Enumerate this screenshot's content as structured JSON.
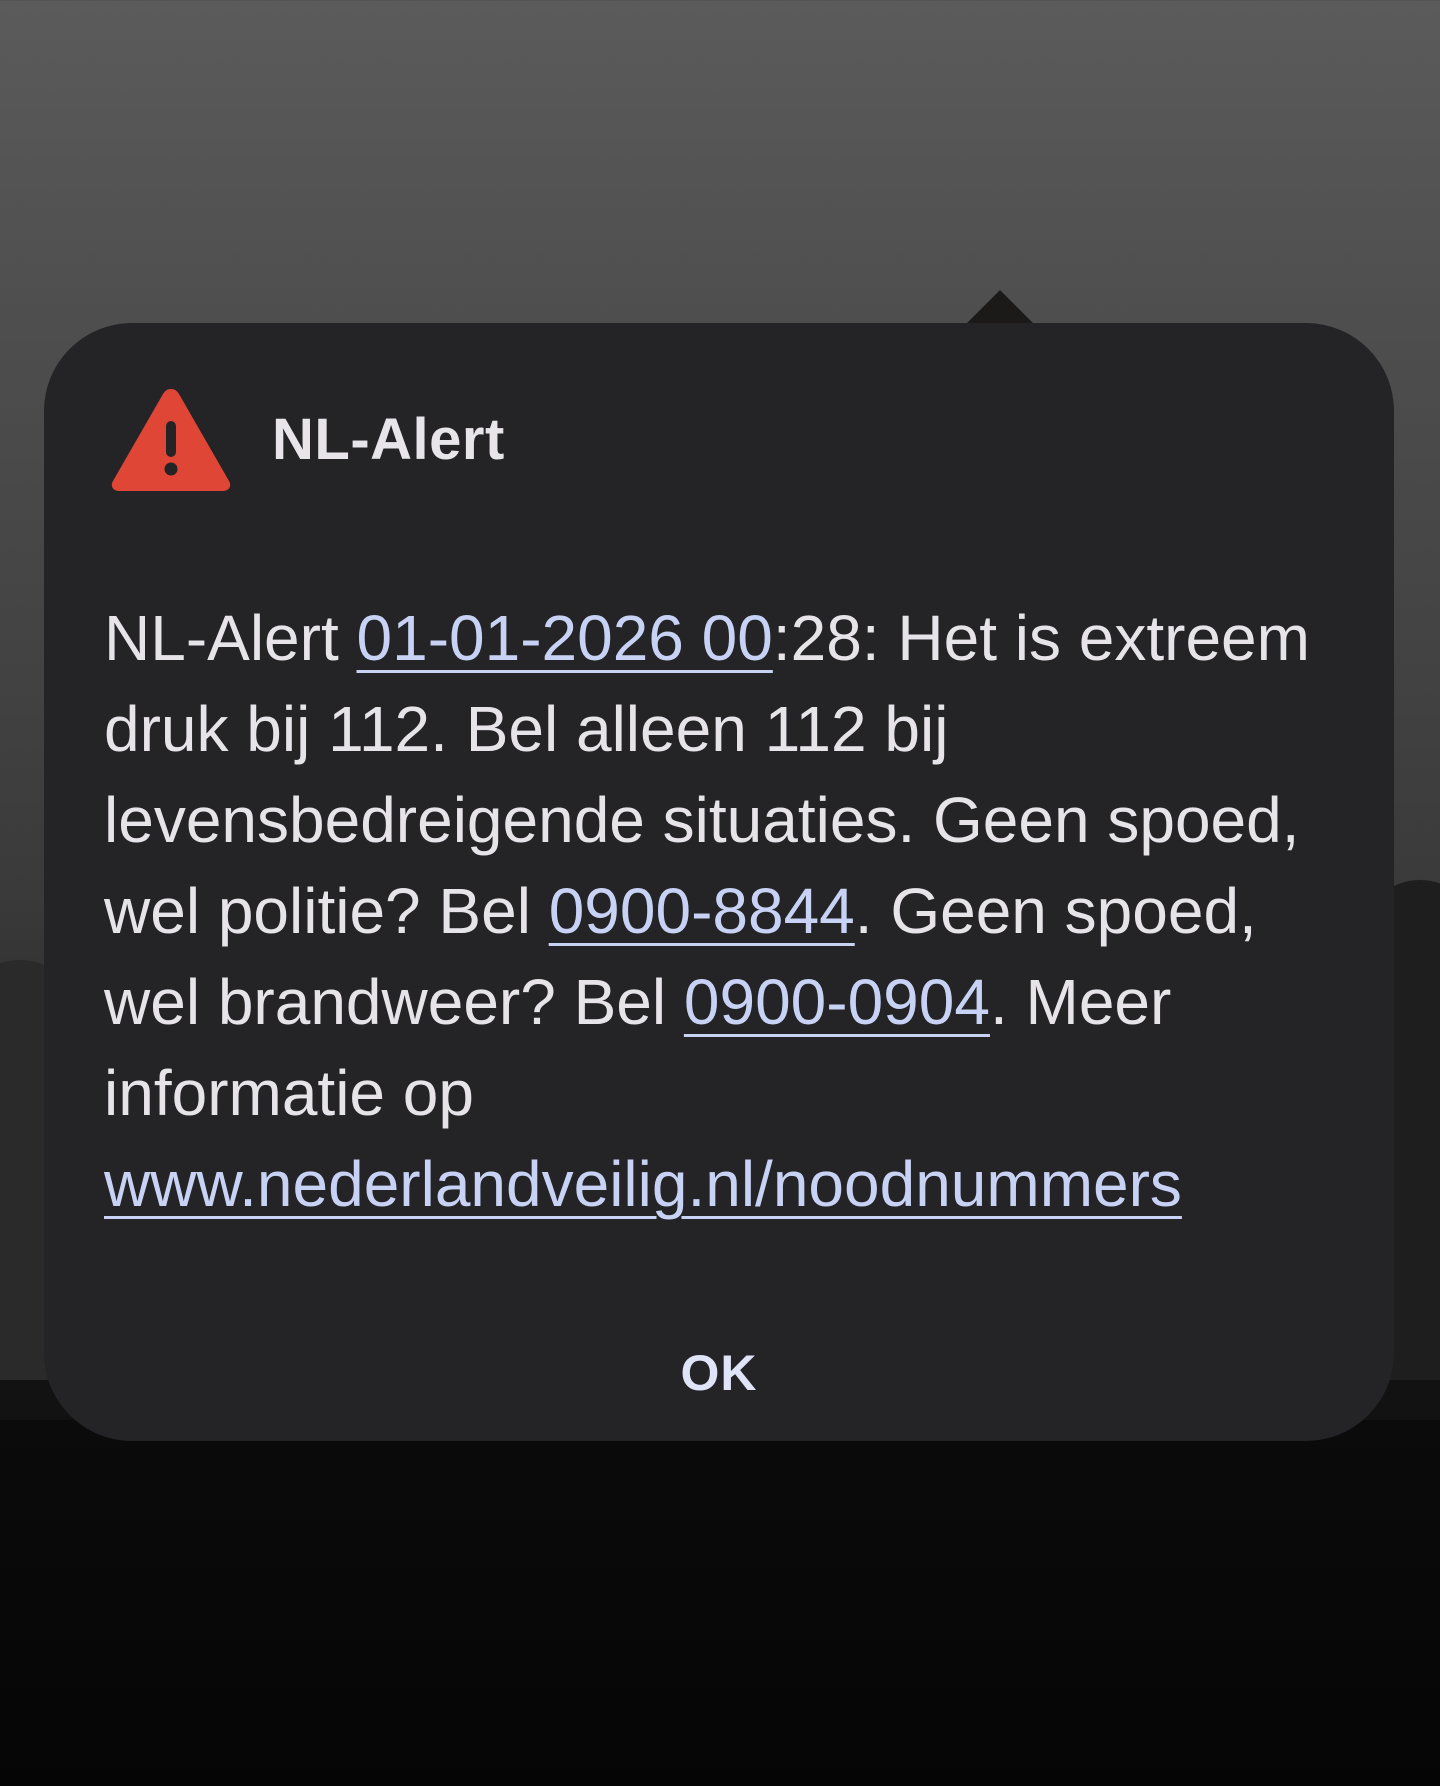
{
  "dialog": {
    "title": "NL-Alert",
    "icon": "warning-triangle-icon",
    "icon_color": "#e04636",
    "message": {
      "prefix": "NL-Alert ",
      "date_link": "01-01-2026 00",
      "part1": ":28: Het is extreem druk bij 112. Bel alleen 112 bij levensbedreigende situaties. Geen spoed, wel politie? Bel ",
      "police_number": "0900-8844",
      "part2": ". Geen spoed, wel brandweer? Bel ",
      "fire_number": "0900-0904",
      "part3": ". Meer informatie op ",
      "url": "www.nederlandveilig.nl/noodnummers"
    },
    "ok_label": "OK"
  },
  "colors": {
    "dialog_background": "#242427",
    "link": "#c7d2f4",
    "text": "#e6e4e9"
  }
}
